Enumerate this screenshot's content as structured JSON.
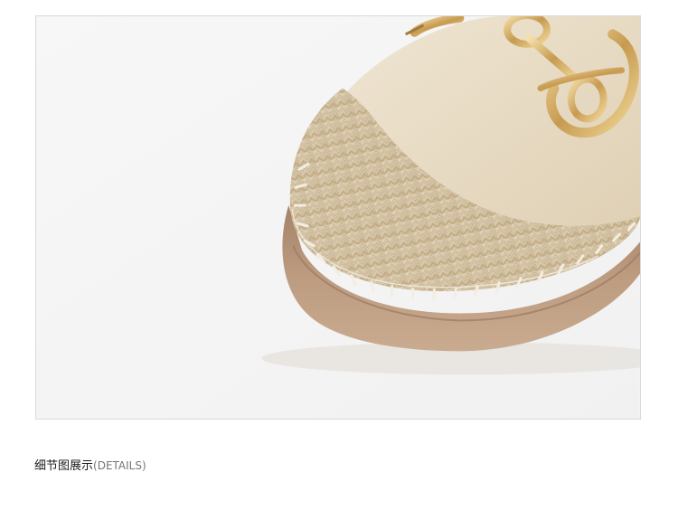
{
  "caption": {
    "chinese": "细节图展示",
    "english": "(DETAILS)"
  },
  "colors": {
    "frame_background": "#f5f5f5",
    "frame_border": "#d9d9d9",
    "suede_upper": "#e8dcc6",
    "jute_braid": "#d8c8a8",
    "stitching": "#f2ece0",
    "rubber_sole": "#b8977a",
    "gold_hardware": "#d6b370"
  },
  "photo": {
    "subject_icon": "shoe-detail-photo"
  }
}
